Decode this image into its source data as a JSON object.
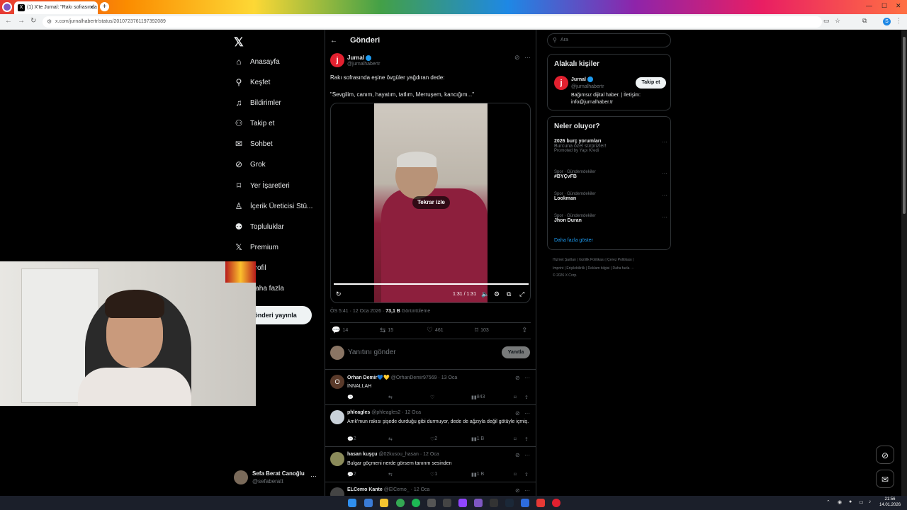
{
  "browser": {
    "tab_title": "(1) X'te Jurnal: \"Rakı sofrasında",
    "url": "x.com/jurnalhabertr/status/2010723761197392089"
  },
  "nav": {
    "items": [
      {
        "icon": "home-icon",
        "glyph": "⌂",
        "label": "Anasayfa"
      },
      {
        "icon": "search-icon",
        "glyph": "⚲",
        "label": "Keşfet"
      },
      {
        "icon": "bell-icon",
        "glyph": "♫",
        "label": "Bildirimler"
      },
      {
        "icon": "follow-icon",
        "glyph": "⚇",
        "label": "Takip et"
      },
      {
        "icon": "mail-icon",
        "glyph": "✉",
        "label": "Sohbet"
      },
      {
        "icon": "grok-icon",
        "glyph": "⊘",
        "label": "Grok"
      },
      {
        "icon": "bookmark-icon",
        "glyph": "⌑",
        "label": "Yer İşaretleri"
      },
      {
        "icon": "creator-icon",
        "glyph": "♙",
        "label": "İçerik Üreticisi Stü..."
      },
      {
        "icon": "communities-icon",
        "glyph": "⚉",
        "label": "Topluluklar"
      },
      {
        "icon": "x-premium-icon",
        "glyph": "𝕏",
        "label": "Premium"
      },
      {
        "icon": "profile-icon",
        "glyph": "☺",
        "label": "Profil"
      },
      {
        "icon": "more-icon",
        "glyph": "⋯",
        "label": "Daha fazla"
      }
    ],
    "post_button": "Gönderi yayınla",
    "account": {
      "name": "Sefa Berat Canoğlu",
      "handle": "@sefaberatt"
    }
  },
  "main": {
    "title": "Gönderi",
    "post": {
      "author": "Jurnal",
      "avatar_letter": "j",
      "handle": "@jurnalhabertr",
      "text_line1": "Rakı sofrasında eşine övgüler yağdıran dede:",
      "text_line2": "\"Sevgilim, canım, hayatım, tatlım, Merruşem, kancığım...\"",
      "replay": "Tekrar izle",
      "video_time": "1:31 / 1:31",
      "progress": 1.0,
      "time": "ÖS 5:41 · 12 Oca 2026 · ",
      "views": "73,1 B",
      "views_label": " Görüntüleme",
      "replies": "14",
      "reposts": "15",
      "likes": "461",
      "bookmarks": "103"
    },
    "reply_placeholder": "Yanıtını gönder",
    "reply_button": "Yanıtla",
    "comments": [
      {
        "name": "Orhan Demir💙💛",
        "handle": "@OrhanDemir97569 · 13 Oca",
        "text": "İNNALLAH",
        "avatar_letter": "O",
        "color": "#5a3a2a",
        "views": "843",
        "r": "",
        "rt": "",
        "l": ""
      },
      {
        "name": "phleagles",
        "handle": "@phleagles2 · 12 Oca",
        "text": "Amk'mun rakısı şişede durduğu gibi durmuyor, dede  de ağzıyla değil götüyle içmiş.",
        "avatar_letter": "",
        "color": "#c9d1d9",
        "views": "1 B",
        "r": "2",
        "rt": "",
        "l": "2"
      },
      {
        "name": "hasan kuşçu",
        "handle": "@02kusou_hasan · 12 Oca",
        "text": "Bulgar göçmeni nerde görsem tanırım sesinden",
        "avatar_letter": "",
        "color": "#8b8b5a",
        "views": "1 B",
        "r": "2",
        "rt": "",
        "l": "1"
      },
      {
        "name": "ELCemo Kante",
        "handle": "@ElCemo_ · 12 Oca",
        "text": "",
        "avatar_letter": "",
        "color": "#444",
        "views": "",
        "r": "",
        "rt": "",
        "l": ""
      }
    ]
  },
  "right": {
    "search_placeholder": "Ara",
    "related_title": "Alakalı kişiler",
    "related": {
      "name": "Jurnal",
      "handle": "@jurnalhabertr",
      "bio": "Bağımsız dijital haber. | İletişim: info@jurnalhaber.tr",
      "follow": "Takip et"
    },
    "trends_title": "Neler oluyor?",
    "trends": [
      {
        "context": "",
        "title": "2026 burç yorumları",
        "sub": "Burcuna özel sürprizler!",
        "promo": "Promoted by Yapı Kredi"
      },
      {
        "context": "Spor · Gündemdekiler",
        "title": "#BYÇvFB",
        "sub": "",
        "promo": ""
      },
      {
        "context": "Spor · Gündemdekiler",
        "title": "Lookman",
        "sub": "",
        "promo": ""
      },
      {
        "context": "Spor · Gündemdekiler",
        "title": "Jhon Duran",
        "sub": "",
        "promo": ""
      }
    ],
    "show_more": "Daha fazla göster",
    "footer_line1": "Hizmet Şartları  |  Gizlilik Politikası  |  Çerez Politikası  |",
    "footer_line2": "Imprint  |  Erişilebilirlik  |  Reklam bilgisi  |  Daha fazla ···",
    "footer_line3": "© 2026 X Corp."
  },
  "clock": {
    "time": "21:56",
    "date": "14.01.2026"
  }
}
